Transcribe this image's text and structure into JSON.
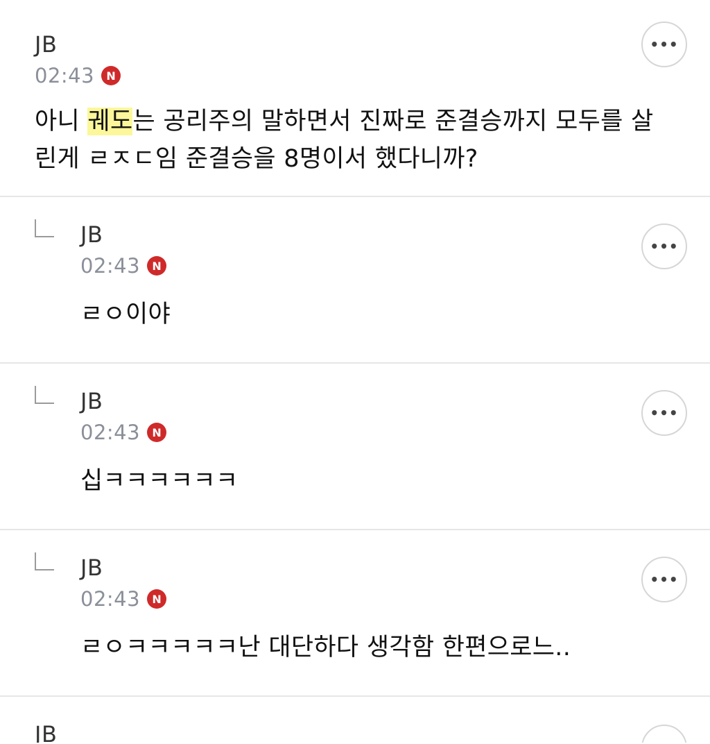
{
  "comments": [
    {
      "author": "JB",
      "time": "02:43",
      "badge": "N",
      "text_before": "아니 ",
      "text_highlight": "궤도",
      "text_after": "는 공리주의 말하면서 진짜로 준결승까지 모두를 살린게 ㄹㅈㄷ임 준결승을 8명이서 했다니까?",
      "more_label": "•••"
    },
    {
      "author": "JB",
      "time": "02:43",
      "badge": "N",
      "text": "ㄹㅇ이야",
      "more_label": "•••"
    },
    {
      "author": "JB",
      "time": "02:43",
      "badge": "N",
      "text": "십ㅋㅋㅋㅋㅋㅋ",
      "more_label": "•••"
    },
    {
      "author": "JB",
      "time": "02:43",
      "badge": "N",
      "text": "ㄹㅇㅋㅋㅋㅋㅋ난 대단하다 생각함 한편으로느..",
      "more_label": "•••"
    },
    {
      "author": "JB",
      "more_label": "•••"
    }
  ],
  "colors": {
    "highlight": "#fbf79a",
    "badge": "#cf2a2a",
    "timestamp": "#8a8f99",
    "divider": "#e6e6e6"
  },
  "icons": {
    "badge": "new-badge-icon",
    "more": "more-options-icon",
    "reply": "reply-arrow-icon"
  }
}
